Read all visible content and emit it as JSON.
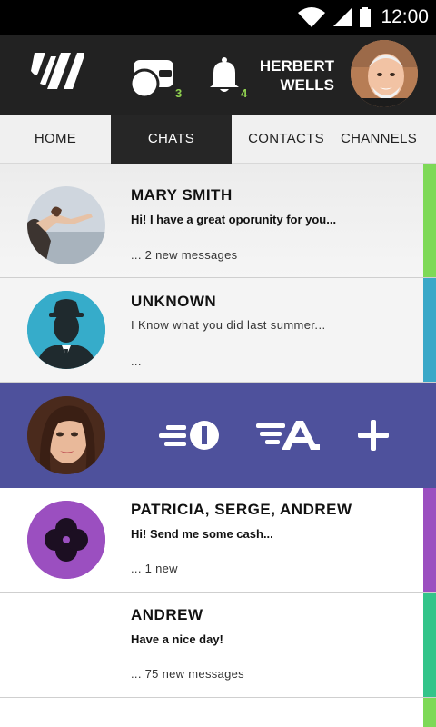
{
  "status_bar": {
    "time": "12:00"
  },
  "header": {
    "wallet_count": "3",
    "notifications_count": "4",
    "user_first": "HERBERT",
    "user_last": "WELLS"
  },
  "tabs": [
    {
      "label": "HOME"
    },
    {
      "label": "CHATS"
    },
    {
      "label": "CONTACTS"
    },
    {
      "label": "CHANNELS"
    }
  ],
  "active_tab": "CHATS",
  "chats": [
    {
      "name": "MARY SMITH",
      "message": "Hi! I have a great oporunity for you...",
      "meta": "...  2 new messages",
      "stripe_color": "#7ed957"
    },
    {
      "name": "UNKNOWN",
      "message": "I Know what you did last summer...",
      "meta": "...",
      "stripe_color": "#3aa8c8"
    },
    {
      "name": "PATRICIA, SERGE, ANDREW",
      "message": "Hi! Send me some cash...",
      "meta": "... 1 new",
      "stripe_color": "#9b4fc0"
    },
    {
      "name": "ANDREW",
      "message": "Have a nice day!",
      "meta": "... 75 new messages",
      "stripe_color": "#33c48a"
    }
  ],
  "colors": {
    "header_bg": "#222222",
    "action_bg": "#4e519c",
    "badge_green": "#8fd14f",
    "stripe_green": "#7ed957",
    "stripe_teal": "#3aa8c8",
    "stripe_purple": "#9b4fc0",
    "stripe_mint": "#33c48a"
  },
  "icons": [
    "wifi-icon",
    "signal-icon",
    "battery-icon",
    "logo-icon",
    "wallet-icon",
    "bell-icon",
    "quick-pay-icon",
    "quick-reply-icon",
    "plus-icon",
    "group-icon",
    "bowler-hat-avatar-icon"
  ]
}
